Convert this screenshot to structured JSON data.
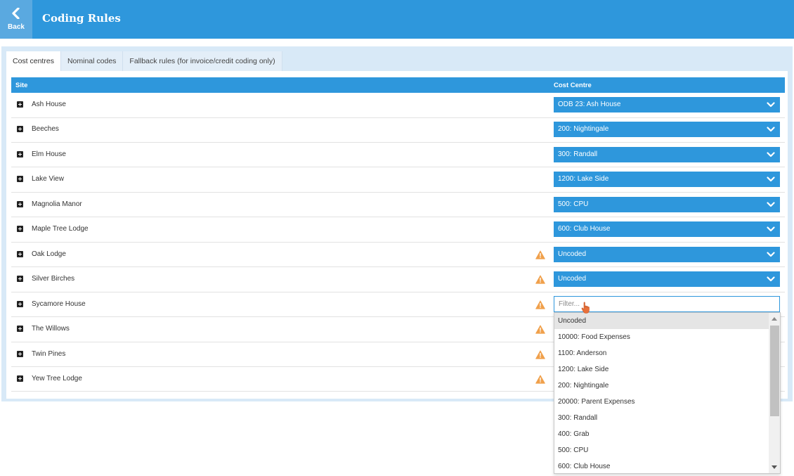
{
  "header": {
    "back_label": "Back",
    "title": "Coding Rules",
    "background_color": "#2e97dc"
  },
  "tabs": [
    {
      "label": "Cost centres",
      "active": true
    },
    {
      "label": "Nominal codes",
      "active": false
    },
    {
      "label": "Fallback rules (for invoice/credit coding only)",
      "active": false
    }
  ],
  "table": {
    "columns": [
      "Site",
      "Cost Centre"
    ],
    "rows": [
      {
        "site": "Ash House",
        "cost_centre": "ODB 23: Ash House",
        "warning": false
      },
      {
        "site": "Beeches",
        "cost_centre": "200: Nightingale",
        "warning": false
      },
      {
        "site": "Elm House",
        "cost_centre": "300: Randall",
        "warning": false
      },
      {
        "site": "Lake View",
        "cost_centre": "1200: Lake Side",
        "warning": false
      },
      {
        "site": "Magnolia Manor",
        "cost_centre": "500: CPU",
        "warning": false
      },
      {
        "site": "Maple Tree Lodge",
        "cost_centre": "600: Club House",
        "warning": false
      },
      {
        "site": "Oak Lodge",
        "cost_centre": "Uncoded",
        "warning": true
      },
      {
        "site": "Silver Birches",
        "cost_centre": "Uncoded",
        "warning": true
      },
      {
        "site": "Sycamore House",
        "cost_centre": "",
        "warning": true,
        "filter_open": true
      },
      {
        "site": "The Willows",
        "cost_centre": "",
        "warning": true
      },
      {
        "site": "Twin Pines",
        "cost_centre": "",
        "warning": true
      },
      {
        "site": "Yew Tree Lodge",
        "cost_centre": "",
        "warning": true
      }
    ]
  },
  "filter": {
    "placeholder": "Filter...",
    "value": ""
  },
  "dropdown": {
    "selected": "Uncoded",
    "options": [
      "Uncoded",
      "10000: Food Expenses",
      "1100: Anderson",
      "1200: Lake Side",
      "200: Nightingale",
      "20000: Parent Expenses",
      "300: Randall",
      "400: Grab",
      "500: CPU",
      "600: Club House"
    ]
  },
  "colors": {
    "accent": "#2e97dc",
    "warning": "#f0a04b",
    "panel": "#d8e9f7"
  },
  "icons": {
    "back": "chevron-left-icon",
    "expand": "plus-square-icon",
    "warning": "warning-triangle-icon",
    "select_arrow": "chevron-down-icon",
    "cursor": "hand-pointer-icon"
  }
}
